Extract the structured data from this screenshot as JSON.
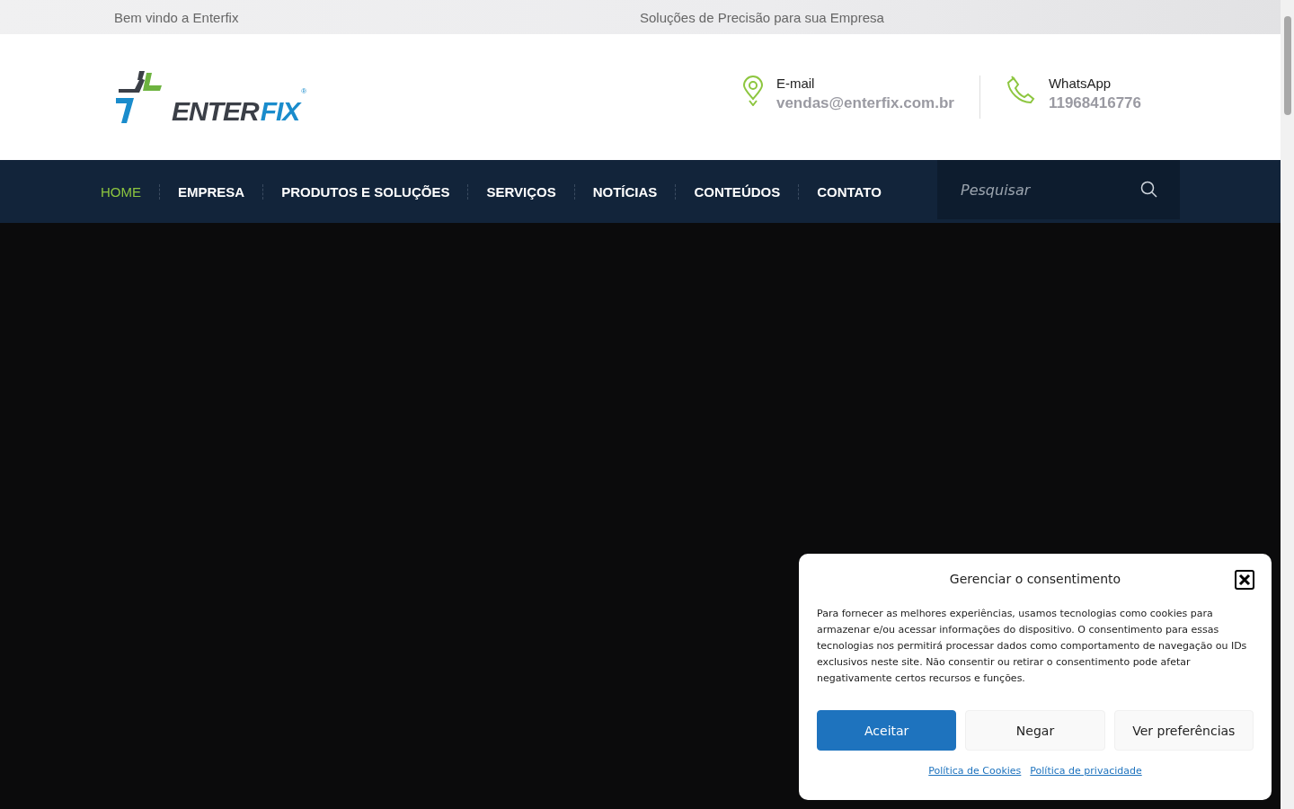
{
  "top_bar": {
    "welcome": "Bem vindo a Enterfix",
    "tagline": "Soluções de Precisão para sua Empresa"
  },
  "logo": {
    "dark_part": "ENTER",
    "accent_part": "FIX",
    "mark": "®"
  },
  "contacts": [
    {
      "kind": "pin",
      "label": "E-mail",
      "value": "vendas@enterfix.com.br"
    },
    {
      "kind": "phone",
      "label": "WhatsApp",
      "value": "11968416776"
    }
  ],
  "nav": [
    {
      "label": "HOME",
      "selected": true
    },
    {
      "label": "EMPRESA",
      "selected": false
    },
    {
      "label": "PRODUTOS E SOLUÇÕES",
      "selected": false
    },
    {
      "label": "SERVIÇOS",
      "selected": false
    },
    {
      "label": "NOTÍCIAS",
      "selected": false
    },
    {
      "label": "CONTEÚDOS",
      "selected": false
    },
    {
      "label": "CONTATO",
      "selected": false
    }
  ],
  "search": {
    "placeholder": "Pesquisar"
  },
  "consent": {
    "title": "Gerenciar o consentimento",
    "text": "Para fornecer as melhores experiências, usamos tecnologias como cookies para armazenar e/ou acessar informações do dispositivo. O consentimento para essas tecnologias nos permitirá processar dados como comportamento de navegação ou IDs exclusivos neste site. Não consentir ou retirar o consentimento pode afetar negativamente certos recursos e funções.",
    "buttons": [
      {
        "label": "Aceitar",
        "kind": "primary"
      },
      {
        "label": "Negar",
        "kind": "secondary"
      },
      {
        "label": "Ver preferências",
        "kind": "secondary"
      }
    ],
    "links": [
      "Política de Cookies",
      "Política de privacidade"
    ]
  }
}
